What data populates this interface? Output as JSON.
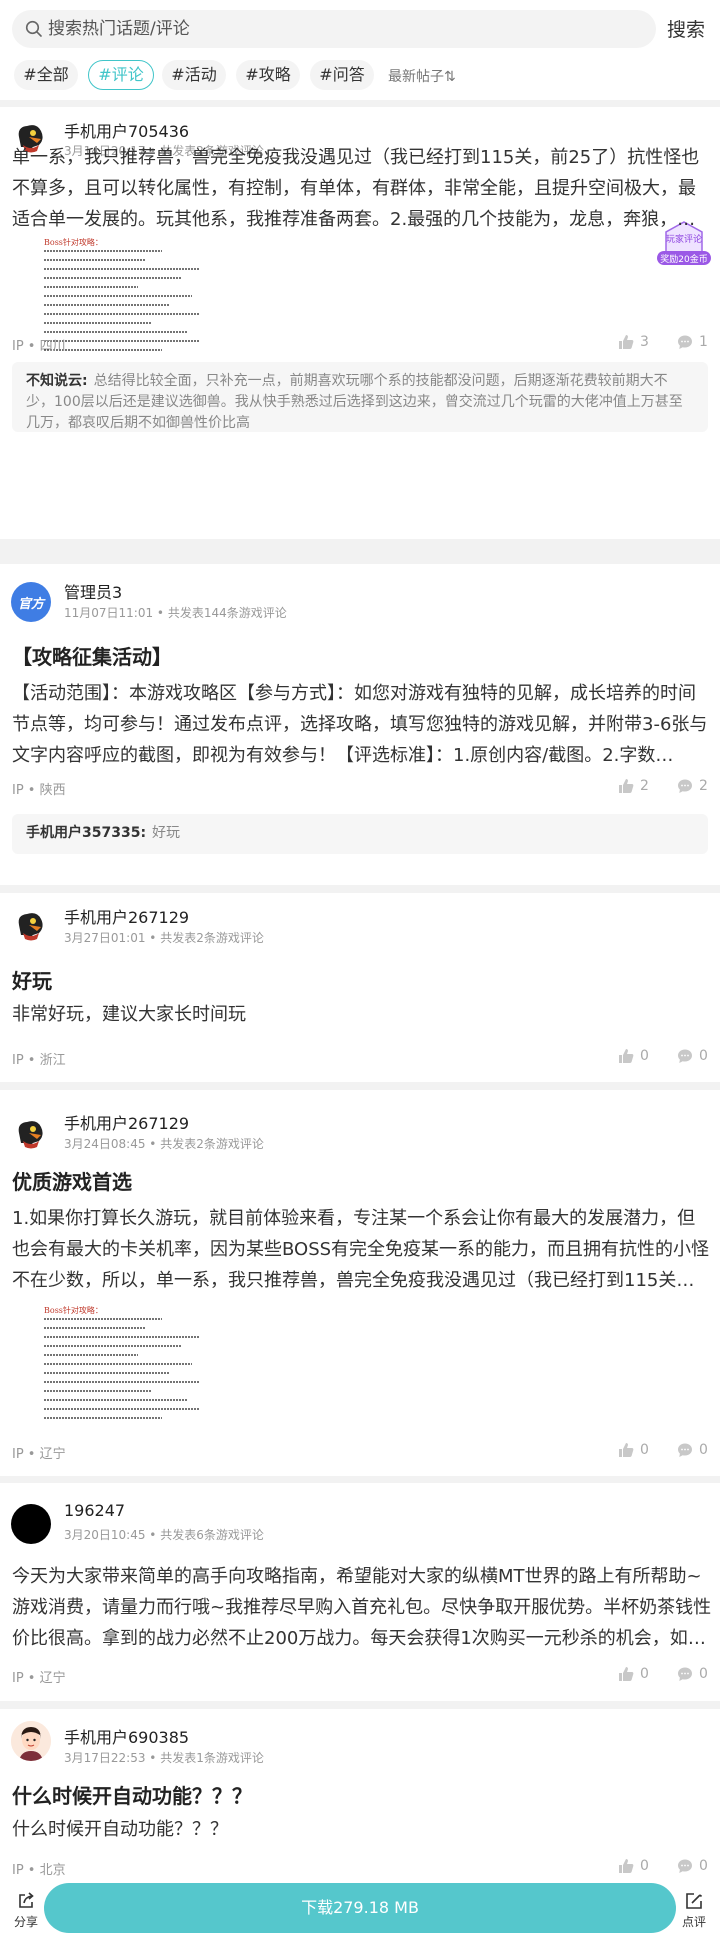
{
  "search": {
    "placeholder": "搜索热门话题/评论",
    "button": "搜索"
  },
  "filters": [
    "#全部",
    "#评论",
    "#活动",
    "#攻略",
    "#问答"
  ],
  "sort_label": "最新帖子⇅",
  "posts": [
    {
      "user": "手机用户705436",
      "meta": "3月14日20:17 • 共发表2条游戏评论",
      "badge_top": "玩家评论",
      "badge_bottom": "奖励20金币",
      "body": "单一系，我只推荐兽，兽完全免疫我没遇见过（我已经打到115关，前25了）抗性怪也不算多，且可以转化属性，有控制，有单体，有群体，非常全能，且提升空间极大，最适合单一发展的。玩其他系，我推荐准备两套。2.最强的几个技能为，龙息，奔狼，凤凰火...",
      "image_title": "Boss针对攻略：",
      "ip": "IP • 四川",
      "likes": "3",
      "comments": "1",
      "reply_user": "不知说云:",
      "reply_text": "总结得比较全面，只补充一点，前期喜欢玩哪个系的技能都没问题，后期逐渐花费较前期大不少，100层以后还是建议选御兽。我从快手熟悉过后选择到这边来，曾交流过几个玩雷的大佬冲值上万甚至几万，都哀叹后期不如御兽性价比高"
    },
    {
      "user": "管理员3",
      "avatar_text": "官方",
      "meta": "11月07日11:01 • 共发表144条游戏评论",
      "title": "【攻略征集活动】",
      "body": "【活动范围】：本游戏攻略区【参与方式】：如您对游戏有独特的见解，成长培养的时间节点等，均可参与！通过发布点评，选择攻略，填写您独特的游戏见解，并附带3-6张与文字内容呼应的截图，即视为有效参与！【评选标准】：1.原创内容/截图。2.字数100+字...",
      "ip": "IP • 陕西",
      "likes": "2",
      "comments": "2",
      "reply_user": "手机用户357335:",
      "reply_text": "好玩"
    },
    {
      "user": "手机用户267129",
      "meta": "3月27日01:01 • 共发表2条游戏评论",
      "title": "好玩",
      "body": "非常好玩，建议大家长时间玩",
      "ip": "IP • 浙江",
      "likes": "0",
      "comments": "0"
    },
    {
      "user": "手机用户267129",
      "meta": "3月24日08:45 • 共发表2条游戏评论",
      "title": "优质游戏首选",
      "body": "1.如果你打算长久游玩，就目前体验来看，专注某一个系会让你有最大的发展潜力，但也会有最大的卡关机率，因为某些BOSS有完全免疫某一系的能力，而且拥有抗性的小怪不在少数，所以，单一系，我只推荐兽，兽完全免疫我没遇见过（我已经打到115关，前25...",
      "image_title": "Boss针对攻略：",
      "ip": "IP • 辽宁",
      "likes": "0",
      "comments": "0"
    },
    {
      "user": "196247",
      "meta": "3月20日10:45 • 共发表6条游戏评论",
      "body": "今天为大家带来简单的高手向攻略指南，希望能对大家的纵横MT世界的路上有所帮助~游戏消费，请量力而行哦~我推荐尽早购入首充礼包。尽快争取开服优势。半杯奶茶钱性价比很高。拿到的战力必然不止200万战力。每天会获得1次购买一元秒杀的机会，如果有...",
      "ip": "IP • 辽宁",
      "likes": "0",
      "comments": "0"
    },
    {
      "user": "手机用户690385",
      "meta": "3月17日22:53 • 共发表1条游戏评论",
      "title": "什么时候开自动功能？？？",
      "body": "什么时候开自动功能？？？",
      "ip": "IP • 北京",
      "likes": "0",
      "comments": "0"
    }
  ],
  "bottom": {
    "share": "分享",
    "download": "下载279.18 MB",
    "review": "点评"
  },
  "colors": {
    "accent": "#41c5c9",
    "download_bg": "#55c7cc"
  }
}
